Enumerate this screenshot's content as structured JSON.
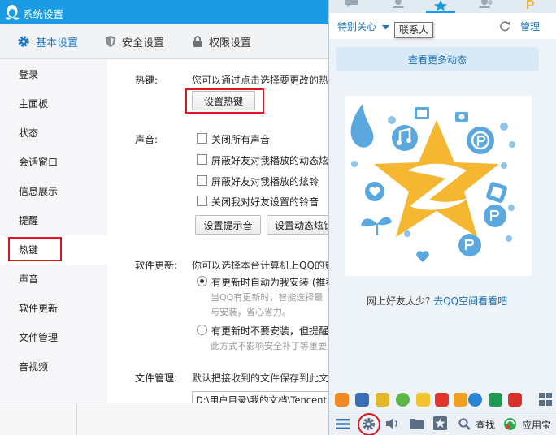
{
  "settings": {
    "title": "系统设置",
    "tabs": [
      {
        "label": "基本设置",
        "icon": "gear-icon",
        "active": true
      },
      {
        "label": "安全设置",
        "icon": "shield-icon",
        "active": false
      },
      {
        "label": "权限设置",
        "icon": "lock-icon",
        "active": false
      }
    ],
    "sidebar": [
      "登录",
      "主面板",
      "状态",
      "会话窗口",
      "信息展示",
      "提醒",
      "热键",
      "声音",
      "软件更新",
      "文件管理",
      "音视频"
    ],
    "active_sidebar": "热键",
    "hotkey": {
      "label": "热键:",
      "desc": "您可以通过点击选择要更改的热",
      "button": "设置热键"
    },
    "sound": {
      "label": "声音:",
      "options": [
        "关闭所有声音",
        "屏蔽好友对我播放的动态炫",
        "屏蔽好友对我播放的炫铃",
        "关闭我对好友设置的铃音"
      ],
      "buttons": [
        "设置提示音",
        "设置动态炫铃"
      ]
    },
    "update": {
      "label": "软件更新:",
      "desc": "你可以选择本台计算机上QQ的更",
      "option1": "有更新时自动为我安装 (推荐",
      "option1_note1": "当QQ有更新时，智能选择最",
      "option1_note2": "与安装，省心省力。",
      "option2": "有更新时不要安装，但提醒",
      "option2_note": "此方式不影响安全补丁等重要"
    },
    "files": {
      "label": "文件管理:",
      "desc": "默认把接收到的文件保存到此文",
      "path": "D:\\用户目录\\我的文档\\Tencent"
    }
  },
  "qq": {
    "special_care": "特别关心",
    "tooltip": "联系人",
    "manage": "管理",
    "more_feeds": "查看更多动态",
    "few_friends": "网上好友太少?",
    "go_link": "去QQ空间看看吧",
    "toolbar": {
      "search": "查找",
      "appstore": "应用宝"
    }
  },
  "colors": {
    "title_bar": "#1a9be4",
    "link": "#1a72b8",
    "highlight_red": "#e0161f",
    "star": "#f5b731"
  }
}
